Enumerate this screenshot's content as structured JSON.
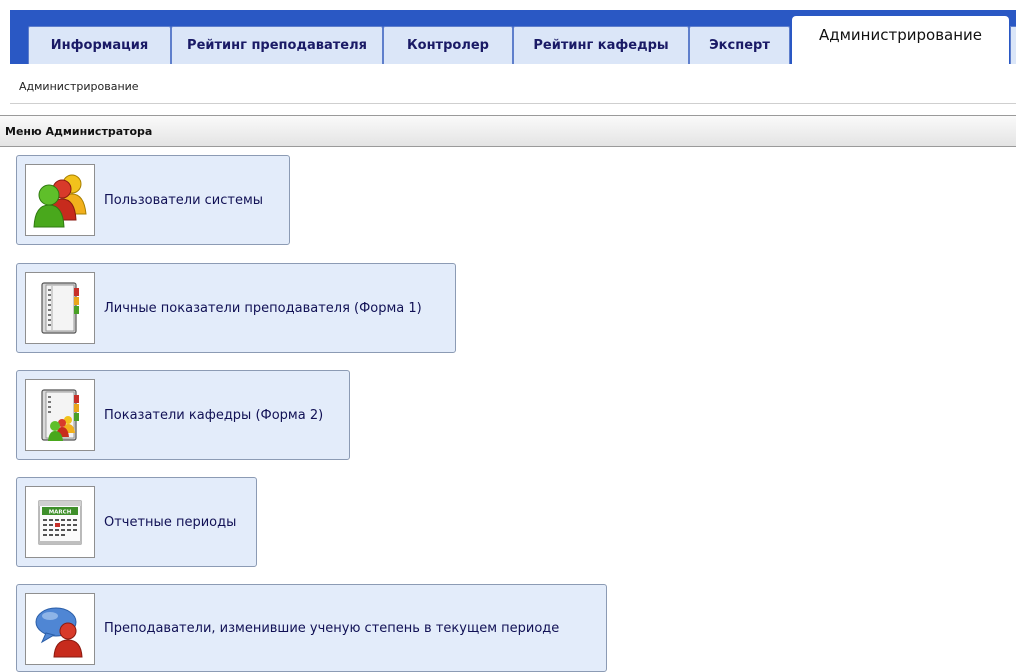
{
  "tabs": [
    {
      "label": "Информация",
      "active": false
    },
    {
      "label": "Рейтинг преподавателя",
      "active": false
    },
    {
      "label": "Контролер",
      "active": false
    },
    {
      "label": "Рейтинг кафедры",
      "active": false
    },
    {
      "label": "Эксперт",
      "active": false
    },
    {
      "label": "Администрирование",
      "active": true
    }
  ],
  "breadcrumb": "Администрирование",
  "section_title": "Меню Администратора",
  "menu_items": [
    {
      "label": "Пользователи системы",
      "icon": "users-group-icon"
    },
    {
      "label": "Личные показатели преподавателя (Форма 1)",
      "icon": "binder-icon"
    },
    {
      "label": "Показатели кафедры (Форма 2)",
      "icon": "binder-users-icon"
    },
    {
      "label": "Отчетные периоды",
      "icon": "calendar-icon"
    },
    {
      "label": "Преподаватели, изменившие ученую степень в текущем периоде",
      "icon": "user-speech-icon"
    }
  ],
  "calendar_month": "MARCH",
  "colors": {
    "tab_bar": "#2a58c4",
    "tab_inactive": "#dbe6f8",
    "menu_button_bg": "#e3ecfa",
    "menu_text": "#111155"
  }
}
